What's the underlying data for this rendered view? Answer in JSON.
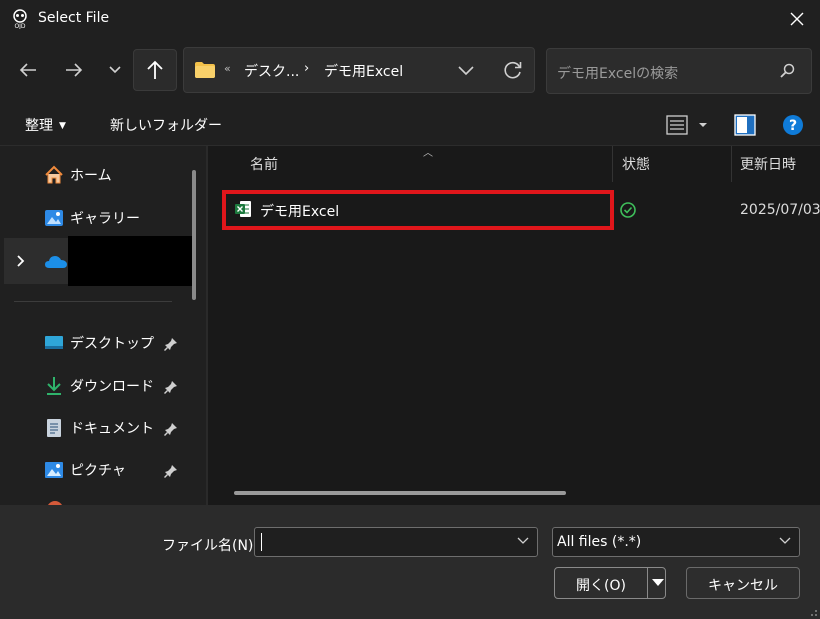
{
  "window": {
    "title": "Select File"
  },
  "nav": {
    "address": {
      "overflow": "«",
      "seg1": "デスク...",
      "sep": "›",
      "seg2": "デモ用Excel"
    },
    "search_placeholder": "デモ用Excelの検索"
  },
  "toolbar": {
    "organize": "整理",
    "new_folder": "新しいフォルダー"
  },
  "sidebar": {
    "items": [
      {
        "label": "ホーム",
        "icon": "home-icon"
      },
      {
        "label": "ギャラリー",
        "icon": "gallery-icon"
      },
      {
        "label": "",
        "icon": "onedrive-icon"
      },
      {
        "label": "デスクトップ",
        "icon": "desktop-icon"
      },
      {
        "label": "ダウンロード",
        "icon": "download-icon"
      },
      {
        "label": "ドキュメント",
        "icon": "document-icon"
      },
      {
        "label": "ピクチャ",
        "icon": "pictures-icon"
      }
    ]
  },
  "filelist": {
    "columns": {
      "name": "名前",
      "status": "状態",
      "modified": "更新日時"
    },
    "rows": [
      {
        "name": "デモ用Excel",
        "modified": "2025/07/03",
        "icon": "excel-icon",
        "status_icon": "synced-check-icon"
      }
    ]
  },
  "bottom": {
    "filename_label": "ファイル名(N):",
    "filename_value": "",
    "filetype": "All files (*.*)",
    "open": "開く(O)",
    "cancel": "キャンセル"
  },
  "colors": {
    "highlight_border": "#e0161b",
    "accent": "#0f7bd8",
    "excel_green": "#1d7a3e"
  }
}
